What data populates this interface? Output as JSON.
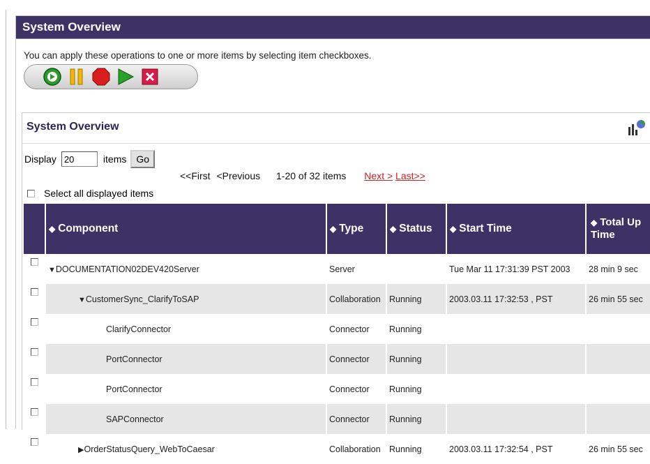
{
  "page": {
    "header_title": "System Overview",
    "instructions": "You can apply these operations to one or more items by selecting item checkboxes."
  },
  "toolbar": {
    "buttons": [
      {
        "icon": "start-icon",
        "color": "#2a9a2a"
      },
      {
        "icon": "pause-icon",
        "color": "#f2b700"
      },
      {
        "icon": "stop-icon",
        "color": "#d81e1e"
      },
      {
        "icon": "play-icon",
        "color": "#27a327"
      },
      {
        "icon": "delete-icon",
        "color": "#d51c4a"
      }
    ]
  },
  "panel": {
    "title": "System Overview",
    "display_label": "Display",
    "display_value": "20",
    "items_label": "items",
    "go_label": "Go",
    "pager": {
      "first": "<<First",
      "previous": "<Previous",
      "range": "1-20 of 32 items",
      "next": "Next >",
      "last": "Last>>"
    },
    "select_all_label": "Select all displayed items"
  },
  "table": {
    "headers": {
      "component": "Component",
      "type": "Type",
      "status": "Status",
      "start_time": "Start Time",
      "total_up_time": "Total Up Time"
    },
    "rows": [
      {
        "component": "DOCUMENTATION02DEV420Server",
        "type": "Server",
        "status": "",
        "start_time": "Tue Mar 11 17:31:39 PST 2003",
        "total_up_time": "28 min 9 sec"
      },
      {
        "component": "CustomerSync_ClarifyToSAP",
        "type": "Collaboration",
        "status": "Running",
        "start_time": "2003.03.11 17:32:53 , PST",
        "total_up_time": "26 min 55 sec"
      },
      {
        "component": "ClarifyConnector",
        "type": "Connector",
        "status": "Running",
        "start_time": "",
        "total_up_time": ""
      },
      {
        "component": "PortConnector",
        "type": "Connector",
        "status": "Running",
        "start_time": "",
        "total_up_time": ""
      },
      {
        "component": "PortConnector",
        "type": "Connector",
        "status": "Running",
        "start_time": "",
        "total_up_time": ""
      },
      {
        "component": "SAPConnector",
        "type": "Connector",
        "status": "Running",
        "start_time": "",
        "total_up_time": ""
      },
      {
        "component": "OrderStatusQuery_WebToCaesar",
        "type": "Collaboration",
        "status": "Running",
        "start_time": "2003.03.11 17:32:54 , PST",
        "total_up_time": "26 min 55 sec"
      }
    ]
  },
  "colors": {
    "header_bg": "#3d3266",
    "row_shade": "#e6e6e6",
    "link_red": "#cc2222"
  }
}
